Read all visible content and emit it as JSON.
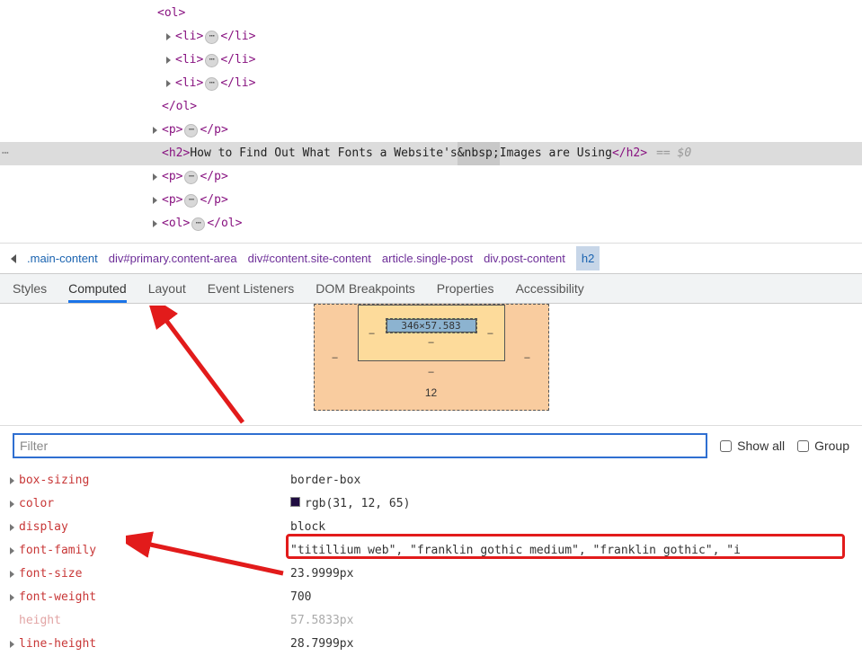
{
  "dom": {
    "ol_open": "<ol>",
    "li_open": "<li>",
    "li_close": "</li>",
    "ol_close": "</ol>",
    "p_open": "<p>",
    "p_close": "</p>",
    "h2_open": "<h2>",
    "h2_text_a": "How to Find Out What Fonts a Website's",
    "h2_nbsp": "&nbsp;",
    "h2_text_b": "Images are Using",
    "h2_close": "</h2>",
    "ol2_open": "<ol>",
    "ol2_close": "</ol>",
    "eq0": "== $0",
    "dots": "⋯"
  },
  "breadcrumb": {
    "items": [
      ".main-content",
      "div#primary.content-area",
      "div#content.site-content",
      "article.single-post",
      "div.post-content",
      "h2"
    ]
  },
  "tabs": {
    "styles": "Styles",
    "computed": "Computed",
    "layout": "Layout",
    "event_listeners": "Event Listeners",
    "dom_breakpoints": "DOM Breakpoints",
    "properties": "Properties",
    "accessibility": "Accessibility"
  },
  "boxmodel": {
    "content": "346×57.583",
    "dash": "–",
    "margin_bottom": "12"
  },
  "filter": {
    "placeholder": "Filter",
    "show_all": "Show all",
    "group": "Group"
  },
  "props": [
    {
      "name": "box-sizing",
      "value": "border-box"
    },
    {
      "name": "color",
      "value": "rgb(31, 12, 65)",
      "swatch": true
    },
    {
      "name": "display",
      "value": "block"
    },
    {
      "name": "font-family",
      "value": "\"titillium web\", \"franklin gothic medium\", \"franklin gothic\", \"i",
      "highlight": true
    },
    {
      "name": "font-size",
      "value": "23.9999px"
    },
    {
      "name": "font-weight",
      "value": "700"
    },
    {
      "name": "height",
      "value": "57.5833px",
      "faded": true
    },
    {
      "name": "line-height",
      "value": "28.7999px"
    }
  ]
}
